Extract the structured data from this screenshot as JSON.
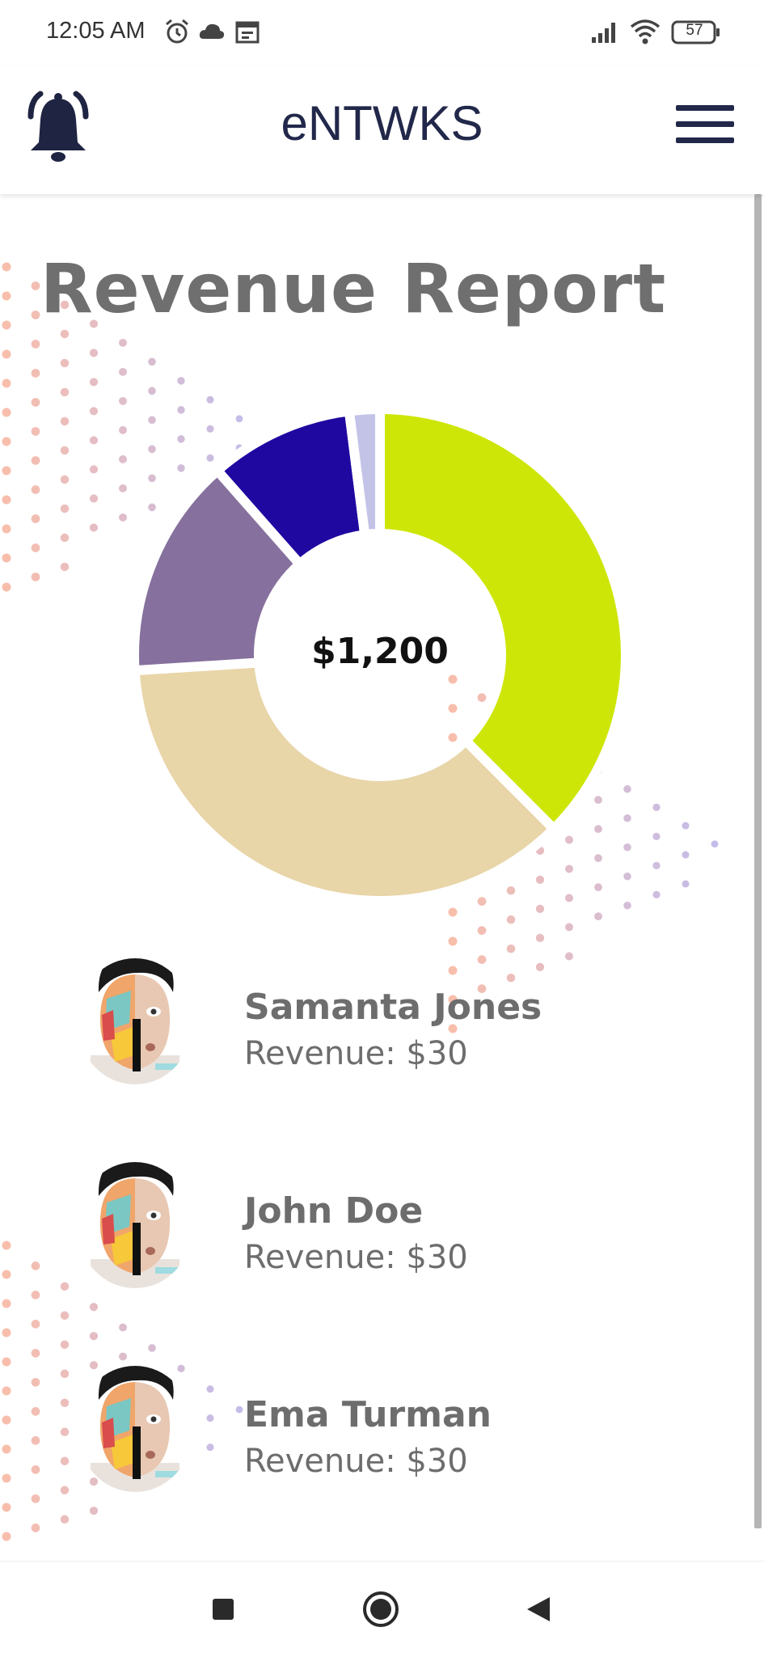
{
  "status_bar": {
    "time": "12:05 AM",
    "icons": [
      "alarm-icon",
      "cloud-icon",
      "calendar-icon",
      "signal-icon",
      "wifi-icon",
      "battery-icon"
    ],
    "battery": "57"
  },
  "app_bar": {
    "title": "eNTWKS",
    "left_icon": "bell-icon",
    "right_icon": "hamburger-menu-icon"
  },
  "page": {
    "title": "Revenue Report"
  },
  "chart_data": {
    "type": "pie",
    "center_label": "$1,200",
    "slices": [
      {
        "value": 37.5,
        "color": "#cde608"
      },
      {
        "value": 36.5,
        "color": "#e8d5a8"
      },
      {
        "value": 14.5,
        "color": "#86709d"
      },
      {
        "value": 9.5,
        "color": "#1f08a0"
      },
      {
        "value": 2.0,
        "color": "#c3c3e8"
      }
    ]
  },
  "list": {
    "items": [
      {
        "name": "Samanta Jones",
        "revenue": "Revenue: $30"
      },
      {
        "name": "John Doe",
        "revenue": "Revenue: $30"
      },
      {
        "name": "Ema Turman",
        "revenue": "Revenue: $30"
      }
    ]
  },
  "nav_bar": {
    "icons": [
      "recents-square-icon",
      "home-circle-icon",
      "back-triangle-icon"
    ]
  },
  "colors": {
    "brand_dark": "#22284a",
    "text_gray": "#6d6d6d"
  }
}
